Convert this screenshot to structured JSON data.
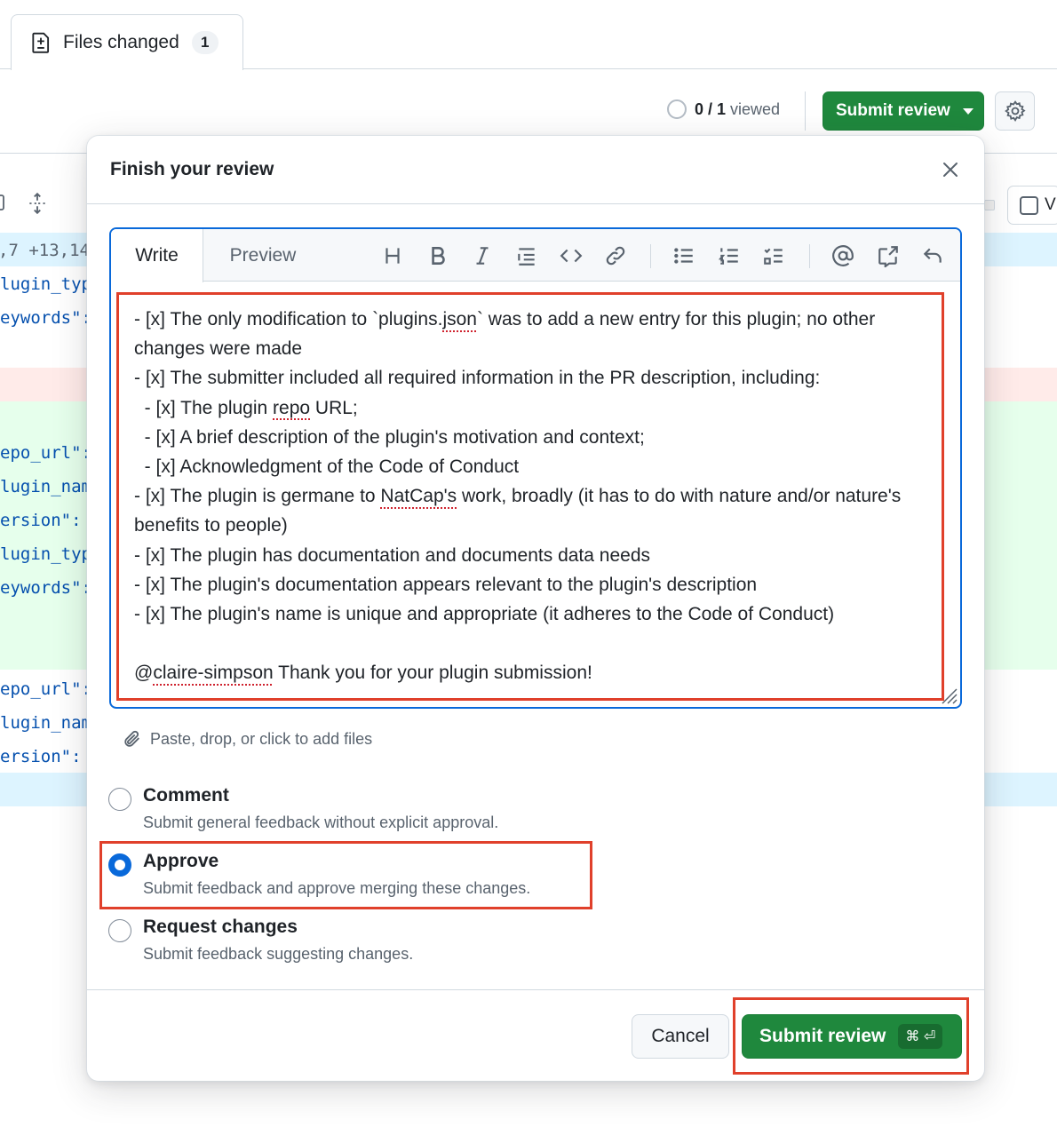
{
  "tabs": {
    "files_changed_label": "Files changed",
    "files_changed_count": "1",
    "icon": "file-diff-icon"
  },
  "toolbar": {
    "viewed_count": "0 / 1",
    "viewed_label": "viewed",
    "submit_review_label": "Submit review",
    "settings_icon": "gear-icon"
  },
  "diff": {
    "hunk": ",7 +13,14",
    "view_label": "V",
    "lines": [
      {
        "text": "lugin_typ",
        "kind": "context"
      },
      {
        "text": "eywords\":",
        "kind": "context"
      },
      {
        "text": "",
        "kind": "deleted"
      },
      {
        "text": "",
        "kind": "added"
      },
      {
        "text": "epo_url\":",
        "kind": "added"
      },
      {
        "text": "lugin_nam",
        "kind": "added"
      },
      {
        "text": "ersion\":",
        "kind": "added"
      },
      {
        "text": "lugin_typ",
        "kind": "added"
      },
      {
        "text": "eywords\":",
        "kind": "added"
      },
      {
        "text": "",
        "kind": "added"
      },
      {
        "text": "",
        "kind": "added"
      },
      {
        "text": "epo_url\":",
        "kind": "context"
      },
      {
        "text": "lugin_nam",
        "kind": "context"
      },
      {
        "text": "ersion\":",
        "kind": "context"
      }
    ]
  },
  "modal": {
    "title": "Finish your review",
    "close_icon": "x-icon",
    "editor": {
      "write_tab": "Write",
      "preview_tab": "Preview",
      "toolbar_icons": [
        "heading-icon",
        "bold-icon",
        "italic-icon",
        "quote-icon",
        "code-icon",
        "link-icon",
        "unordered-list-icon",
        "ordered-list-icon",
        "task-list-icon",
        "mention-icon",
        "reference-icon",
        "undo-icon"
      ],
      "text": {
        "l1a": "- [x] The only modification to `plugins.",
        "l1b": "json",
        "l1c": "` was to add a new entry for this plugin; no other changes were made\n- [x] The submitter included all required information in the PR description, including:\n  - [x] The plugin ",
        "l2b": "repo",
        "l2c": " URL;\n  - [x] A brief description of the plugin's motivation and context;\n  - [x] Acknowledgment of the Code of Conduct\n- [x] The plugin is germane to ",
        "l3b": "NatCap's",
        "l3c": " work, broadly (it has to do with nature and/or nature's benefits to people)\n- [x] The plugin has documentation and documents data needs\n- [x] The plugin's documentation appears relevant to the plugin's description\n- [x] The plugin's name is unique and appropriate (it adheres to the Code of Conduct)\n\n@",
        "l4b": "claire-simpson",
        "l4c": " Thank you for your plugin submission!"
      }
    },
    "attach_label": "Paste, drop, or click to add files",
    "options": [
      {
        "label": "Comment",
        "desc": "Submit general feedback without explicit approval.",
        "checked": false
      },
      {
        "label": "Approve",
        "desc": "Submit feedback and approve merging these changes.",
        "checked": true
      },
      {
        "label": "Request changes",
        "desc": "Submit feedback suggesting changes.",
        "checked": false
      }
    ],
    "cancel_label": "Cancel",
    "submit_label": "Submit review",
    "submit_shortcut": "⌘ ⏎"
  },
  "colors": {
    "accent_blue": "#0969da",
    "primary_green": "#1f883d",
    "highlight_red": "#e0402b",
    "diff_added": "#e6ffec",
    "diff_deleted": "#ffebe9",
    "diff_hunk": "#ddf4ff"
  }
}
